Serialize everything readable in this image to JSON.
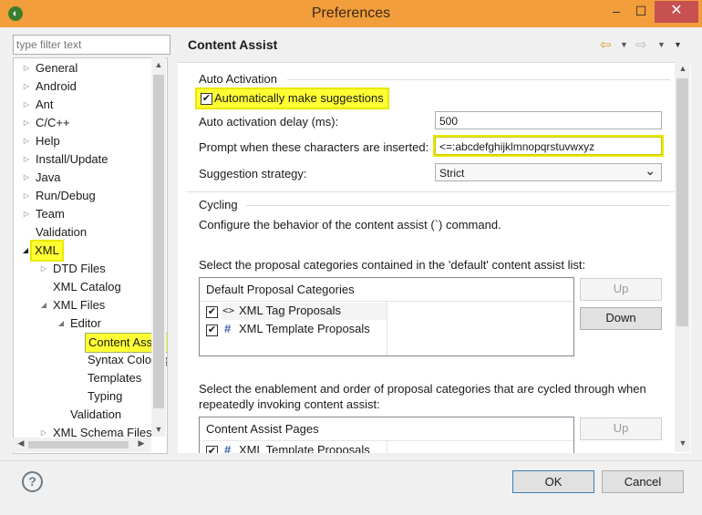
{
  "window": {
    "title": "Preferences",
    "app_icon_glyph": "◐",
    "minimize_glyph": "–",
    "maximize_glyph": "☐",
    "close_glyph": "✕"
  },
  "filter": {
    "placeholder": "type filter text"
  },
  "tree": {
    "items": [
      {
        "label": "General",
        "arrow": "▷"
      },
      {
        "label": "Android",
        "arrow": "▷"
      },
      {
        "label": "Ant",
        "arrow": "▷"
      },
      {
        "label": "C/C++",
        "arrow": "▷"
      },
      {
        "label": "Help",
        "arrow": "▷"
      },
      {
        "label": "Install/Update",
        "arrow": "▷"
      },
      {
        "label": "Java",
        "arrow": "▷"
      },
      {
        "label": "Run/Debug",
        "arrow": "▷"
      },
      {
        "label": "Team",
        "arrow": "▷"
      },
      {
        "label": "Validation",
        "arrow": ""
      },
      {
        "label": "XML",
        "arrow": "◢"
      },
      {
        "label": "DTD Files",
        "arrow": "▷"
      },
      {
        "label": "XML Catalog",
        "arrow": ""
      },
      {
        "label": "XML Files",
        "arrow": "◢"
      },
      {
        "label": "Editor",
        "arrow": "◢"
      },
      {
        "label": "Content Assist",
        "arrow": ""
      },
      {
        "label": "Syntax Coloring",
        "arrow": ""
      },
      {
        "label": "Templates",
        "arrow": ""
      },
      {
        "label": "Typing",
        "arrow": ""
      },
      {
        "label": "Validation",
        "arrow": ""
      },
      {
        "label": "XML Schema Files",
        "arrow": "▷"
      }
    ],
    "scroll_up": "▲",
    "scroll_down": "▼",
    "scroll_left": "◀",
    "scroll_right": "▶"
  },
  "page": {
    "title": "Content Assist",
    "nav": {
      "back": "⇦",
      "dropdown": "▼",
      "forward": "⇨",
      "menu": "▼"
    }
  },
  "auto_activation": {
    "group_title": "Auto Activation",
    "checkbox_label": "Automatically make suggestions",
    "checkbox_checked": "✔",
    "delay_label": "Auto activation delay (ms):",
    "delay_value": "500",
    "prompt_label": "Prompt when these characters are inserted:",
    "prompt_value": "<=:abcdefghijklmnopqrstuvwxyz",
    "strategy_label": "Suggestion strategy:",
    "strategy_value": "Strict",
    "strategy_arrow": "⌄"
  },
  "cycling": {
    "group_title": "Cycling",
    "description": "Configure the behavior of the content assist (`) command.",
    "default_list_label": "Select the proposal categories contained in the 'default' content assist list:",
    "default_header": "Default Proposal Categories",
    "default_rows": [
      {
        "icon": "<>",
        "label": "XML Tag Proposals",
        "check": "✔"
      },
      {
        "icon": "#",
        "label": "XML Template Proposals",
        "check": "✔"
      }
    ],
    "up_label": "Up",
    "down_label": "Down",
    "cycle_list_label_1": "Select the enablement and order of proposal categories that are cycled through when",
    "cycle_list_label_2": "repeatedly invoking content assist:",
    "pages_header": "Content Assist Pages",
    "pages_rows": [
      {
        "icon": "#",
        "label": "XML Template Proposals",
        "check": "✔"
      }
    ],
    "up2_label": "Up"
  },
  "footer": {
    "help_glyph": "?",
    "ok_label": "OK",
    "cancel_label": "Cancel"
  },
  "colors": {
    "titlebar": "#f29e3d",
    "highlight": "#ffff33",
    "close": "#c75050"
  }
}
